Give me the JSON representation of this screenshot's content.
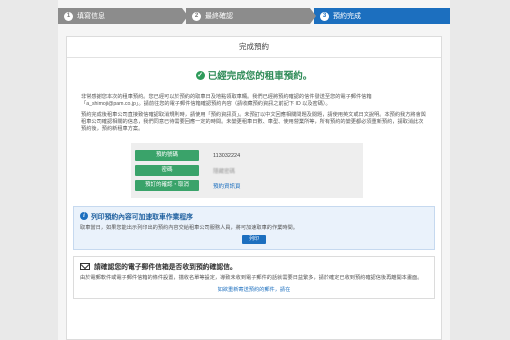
{
  "steps": [
    {
      "num": "1",
      "label": "填寫信息"
    },
    {
      "num": "2",
      "label": "最終確認"
    },
    {
      "num": "3",
      "label": "預約完成"
    }
  ],
  "panel_title": "完成預約",
  "success_message": "已經完成您的租車預約。",
  "paragraph1": "非常感謝您本次的租車預約。您已經可以於預約的取車日及地點領取車輛。我們已經將預約確認的信件發送至您的電子郵件信箱「a_shimoji@pam.co.jp」。請前往您的電子郵件信箱確認預約內容（請收藏預約資訊之前記下 ID 以及密碼）。",
  "paragraph2": "預約完成後租車公司直接致信確認取消規則時，請使用「預約資訊頁」。未預訂以中文回應相關問題及閱題，請使用英文或日文說明。本預約我方將會與租車公司確認相關的信息，我們同意已待需要回應一定的時間。未變更租車日數、車型、使用營業所等，所有預約的變更都必須重新預約，請取消此次預約後，預約新租車方案。",
  "info_rows": [
    {
      "label": "預約號碼",
      "value": "113032224"
    },
    {
      "label": "密碼",
      "value": "隱藏密碼"
    },
    {
      "label": "預訂的確認・取消",
      "value": "預約資訊頁"
    }
  ],
  "print_box": {
    "title": "列印預約內容可加速取車作業程序",
    "text": "取車當日，如果您能出示列印出的預約內容交給租車公司服務人員，將可加速取車的作業時間。",
    "button": "列印"
  },
  "mail_box": {
    "title": "請確認您的電子郵件信箱是否收到預約確認信。",
    "text": "由於電郵軟件或電子郵件信箱的條件設置，擋收名單等設定，導致未收到電子郵件的話就需要日益繁多，請於確定已收到預約確認信後再離開本畫面。",
    "link": "如欲重新寄送預約的郵件，請在"
  }
}
